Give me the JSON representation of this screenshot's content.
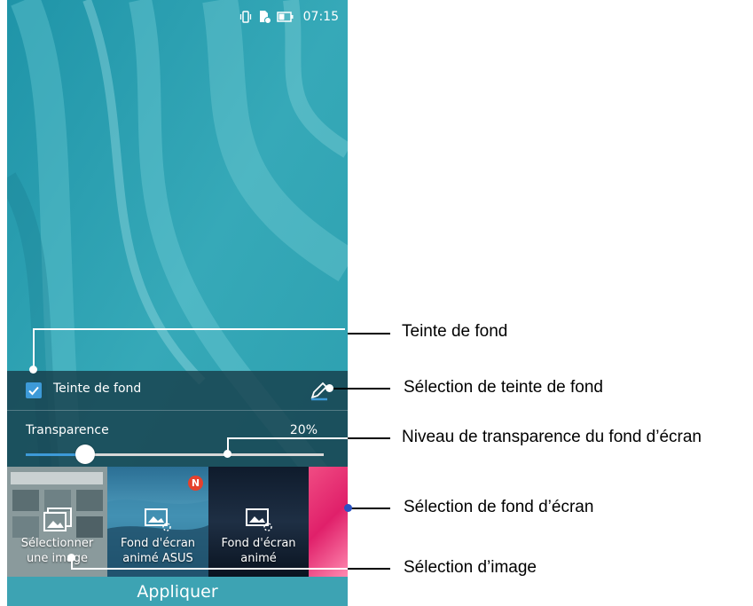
{
  "status_bar": {
    "time": "07:15",
    "icons": [
      "vibrate-icon",
      "sim-icon",
      "battery-icon"
    ]
  },
  "settings": {
    "tint_label": "Teinte de fond",
    "tint_checked": true,
    "transparency_label": "Transparence",
    "transparency_value": "20%",
    "transparency_level": 0.2
  },
  "wallpapers": {
    "select_image_label": "Sélectionner\nune image",
    "asus_live_label": "Fond d'écran\nanimé ASUS",
    "live_label": "Fond d'écran\nanimé",
    "new_badge": "N"
  },
  "apply_label": "Appliquer",
  "callouts": {
    "tint": "Teinte de fond",
    "tint_color": "Sélection de teinte de fond",
    "transparency": "Niveau de transparence du fond d’écran",
    "wallpaper": "Sélection de fond d’écran",
    "image": "Sélection d’image"
  },
  "colors": {
    "accent": "#3d9ad8",
    "apply_bar": "#3da3b3",
    "badge": "#e5412d"
  }
}
